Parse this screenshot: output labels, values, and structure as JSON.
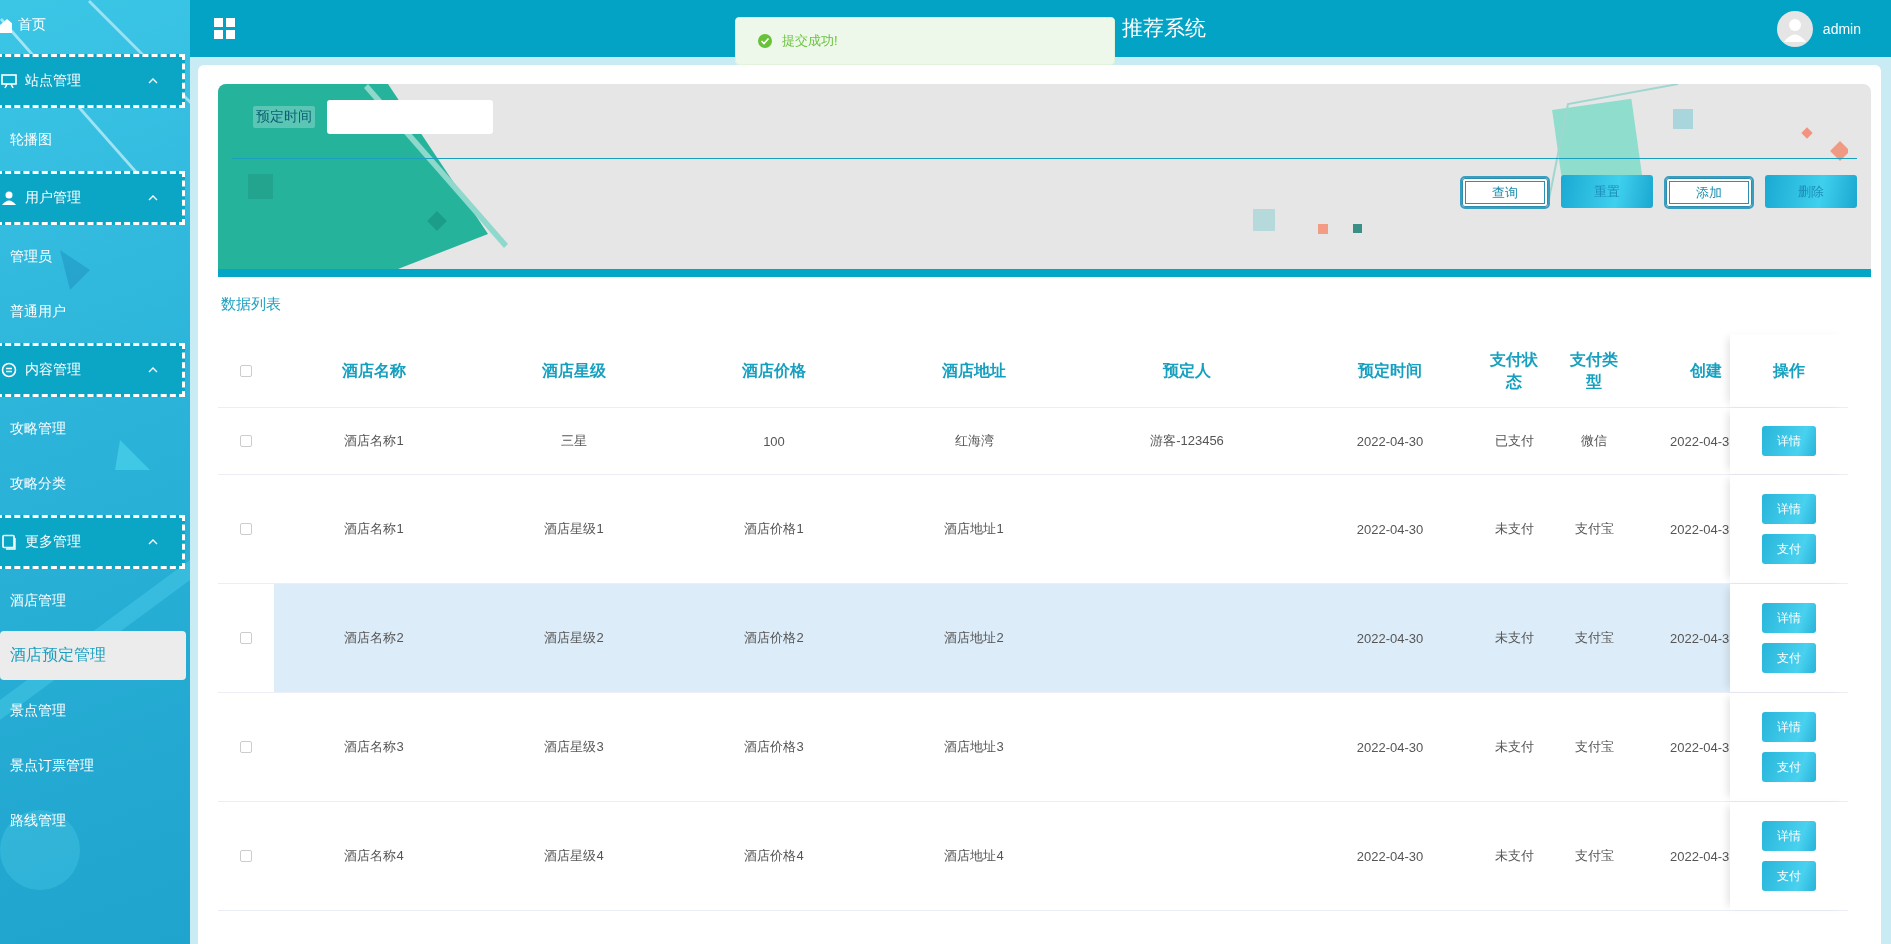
{
  "sidebar": {
    "items": [
      {
        "kind": "link",
        "label": "首页",
        "selected": false
      },
      {
        "kind": "group",
        "label": "站点管理",
        "expanded": true,
        "children": [
          {
            "label": "轮播图",
            "selected": false
          }
        ]
      },
      {
        "kind": "group",
        "label": "用户管理",
        "expanded": true,
        "children": [
          {
            "label": "管理员",
            "selected": false
          },
          {
            "label": "普通用户",
            "selected": false
          }
        ]
      },
      {
        "kind": "group",
        "label": "内容管理",
        "expanded": true,
        "children": [
          {
            "label": "攻略管理",
            "selected": false
          },
          {
            "label": "攻略分类",
            "selected": false
          }
        ]
      },
      {
        "kind": "group",
        "label": "更多管理",
        "expanded": true,
        "children": [
          {
            "label": "酒店管理",
            "selected": false
          },
          {
            "label": "酒店预定管理",
            "selected": true
          },
          {
            "label": "景点管理",
            "selected": false
          },
          {
            "label": "景点订票管理",
            "selected": false
          },
          {
            "label": "路线管理",
            "selected": false
          }
        ]
      }
    ]
  },
  "header": {
    "title": "推荐系统",
    "user": "admin"
  },
  "toast": {
    "message": "提交成功!"
  },
  "search": {
    "fields": [
      {
        "label": "预定时间"
      }
    ],
    "buttons": [
      {
        "label": "查询",
        "kind": "outline"
      },
      {
        "label": "重置",
        "kind": "solid"
      },
      {
        "label": "添加",
        "kind": "outline"
      },
      {
        "label": "删除",
        "kind": "solid"
      }
    ]
  },
  "table": {
    "title": "数据列表",
    "select_all": {
      "checked": false
    },
    "columns": [
      "酒店名称",
      "酒店星级",
      "酒店价格",
      "酒店地址",
      "预定人",
      "预定时间",
      "支付状态",
      "支付类型",
      "创建",
      "操作"
    ],
    "rows": [
      {
        "checked": false,
        "highlighted": false,
        "cells": [
          "酒店名称1",
          "三星",
          "100",
          "红海湾",
          "游客-123456",
          "2022-04-30",
          "已支付",
          "微信",
          "2022-04-3"
        ],
        "actions": [
          "详情"
        ]
      },
      {
        "checked": false,
        "highlighted": false,
        "cells": [
          "酒店名称1",
          "酒店星级1",
          "酒店价格1",
          "酒店地址1",
          null,
          "2022-04-30",
          "未支付",
          "支付宝",
          "2022-04-3"
        ],
        "actions": [
          "详情",
          "支付"
        ]
      },
      {
        "checked": false,
        "highlighted": true,
        "cells": [
          "酒店名称2",
          "酒店星级2",
          "酒店价格2",
          "酒店地址2",
          null,
          "2022-04-30",
          "未支付",
          "支付宝",
          "2022-04-3"
        ],
        "actions": [
          "详情",
          "支付"
        ]
      },
      {
        "checked": false,
        "highlighted": false,
        "cells": [
          "酒店名称3",
          "酒店星级3",
          "酒店价格3",
          "酒店地址3",
          null,
          "2022-04-30",
          "未支付",
          "支付宝",
          "2022-04-3"
        ],
        "actions": [
          "详情",
          "支付"
        ]
      },
      {
        "checked": false,
        "highlighted": false,
        "cells": [
          "酒店名称4",
          "酒店星级4",
          "酒店价格4",
          "酒店地址4",
          null,
          "2022-04-30",
          "未支付",
          "支付宝",
          "2022-04-3"
        ],
        "actions": [
          "详情",
          "支付"
        ]
      }
    ]
  }
}
